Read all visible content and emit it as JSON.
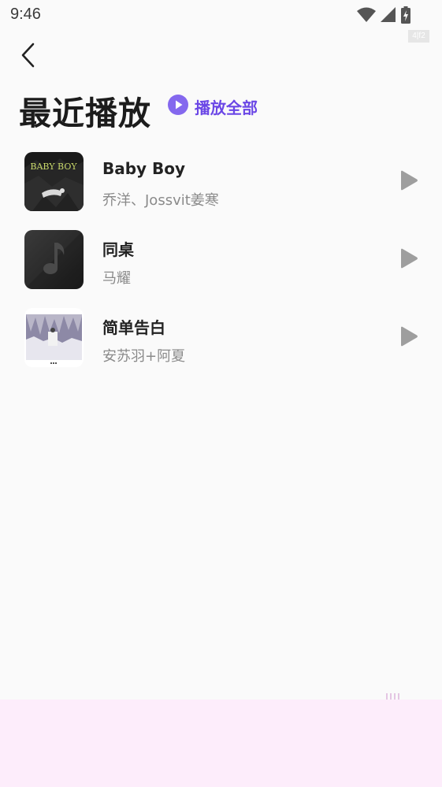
{
  "status_bar": {
    "time": "9:46",
    "corner_tag": "4|f2",
    "icons": [
      "wifi-icon",
      "cellular-signal-icon",
      "battery-charging-icon"
    ]
  },
  "header": {
    "back_icon": "chevron-left-icon",
    "title": "最近播放",
    "play_all_label": "播放全部",
    "play_all_icon": "play-circle-icon",
    "accent_color": "#6b47e6"
  },
  "songs": [
    {
      "title": "Baby Boy",
      "artist": "乔洋、Jossvit姜寒",
      "cover_text": "BABY BOY",
      "cover": "baby-boy-cover"
    },
    {
      "title": "同桌",
      "artist": "马耀",
      "cover": "default-music-note-cover"
    },
    {
      "title": "简单告白",
      "artist": "安苏羽+阿夏",
      "cover": "winter-scene-cover"
    }
  ],
  "colors": {
    "background": "#fafafa",
    "bottom_area": "#fdedfb",
    "row_play_icon": "#9e9e9e"
  }
}
